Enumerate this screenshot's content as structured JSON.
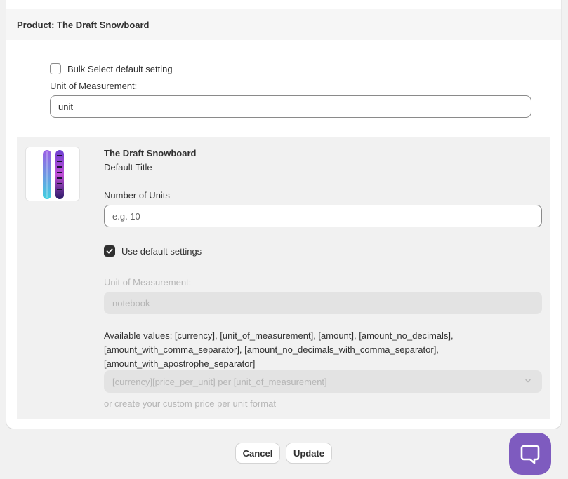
{
  "header": {
    "title": "Product: The Draft Snowboard"
  },
  "bulk": {
    "checkbox_label": "Bulk Select default setting",
    "checked": false,
    "unit_label": "Unit of Measurement:",
    "unit_value": "unit"
  },
  "variant": {
    "product_name": "The Draft Snowboard",
    "variant_title": "Default Title",
    "units_label": "Number of Units",
    "units_placeholder": "e.g. 10",
    "default_checkbox_label": "Use default settings",
    "default_checked": true,
    "unit_label": "Unit of Measurement:",
    "unit_value": "notebook",
    "available_values": "Available values: [currency], [unit_of_measurement], [amount], [amount_no_decimals], [amount_with_comma_separator], [amount_no_decimals_with_comma_separator], [amount_with_apostrophe_separator]",
    "format_selected": "[currency][price_per_unit] per [unit_of_measurement]",
    "custom_hint": "or create your custom price per unit format"
  },
  "footer": {
    "cancel_label": "Cancel",
    "update_label": "Update"
  },
  "icons": {
    "help": "chat-bubble-icon",
    "select": "chevron-down-icon",
    "check": "checkmark-icon"
  },
  "colors": {
    "help_button": "#7e5bbf",
    "checkbox_checked": "#303030"
  }
}
